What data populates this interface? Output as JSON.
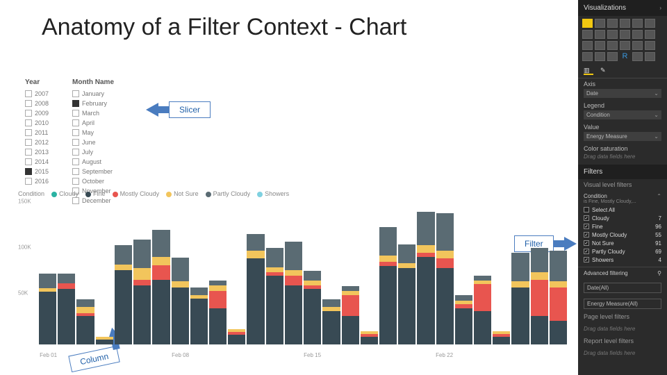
{
  "title": "Anatomy of a Filter Context - Chart",
  "callouts": {
    "slicer": "Slicer",
    "filter": "Filter",
    "column": "Column"
  },
  "slicers": {
    "year": {
      "label": "Year",
      "items": [
        {
          "label": "2007",
          "checked": false
        },
        {
          "label": "2008",
          "checked": false
        },
        {
          "label": "2009",
          "checked": false
        },
        {
          "label": "2010",
          "checked": false
        },
        {
          "label": "2011",
          "checked": false
        },
        {
          "label": "2012",
          "checked": false
        },
        {
          "label": "2013",
          "checked": false
        },
        {
          "label": "2014",
          "checked": false
        },
        {
          "label": "2015",
          "checked": true
        },
        {
          "label": "2016",
          "checked": false
        }
      ]
    },
    "month": {
      "label": "Month Name",
      "items": [
        {
          "label": "January",
          "checked": false
        },
        {
          "label": "February",
          "checked": true
        },
        {
          "label": "March",
          "checked": false
        },
        {
          "label": "April",
          "checked": false
        },
        {
          "label": "May",
          "checked": false
        },
        {
          "label": "June",
          "checked": false
        },
        {
          "label": "July",
          "checked": false
        },
        {
          "label": "August",
          "checked": false
        },
        {
          "label": "September",
          "checked": false
        },
        {
          "label": "October",
          "checked": false
        },
        {
          "label": "November",
          "checked": false
        },
        {
          "label": "December",
          "checked": false
        }
      ]
    }
  },
  "legend": {
    "title": "Condition",
    "items": [
      {
        "label": "Cloudy",
        "color": "#2bb3a3"
      },
      {
        "label": "Fine",
        "color": "#384a54"
      },
      {
        "label": "Mostly Cloudy",
        "color": "#e8554f"
      },
      {
        "label": "Not Sure",
        "color": "#f2c55c"
      },
      {
        "label": "Partly Cloudy",
        "color": "#5a6b73"
      },
      {
        "label": "Showers",
        "color": "#7fd1e0"
      }
    ]
  },
  "chart_data": {
    "type": "bar",
    "stacked": true,
    "ylabel": "",
    "ylim": [
      0,
      150000
    ],
    "yticks": [
      "150K",
      "100K",
      "50K"
    ],
    "xticks": [
      {
        "idx": 0,
        "label": "Feb 01"
      },
      {
        "idx": 7,
        "label": "Feb 08"
      },
      {
        "idx": 14,
        "label": "Feb 15"
      },
      {
        "idx": 21,
        "label": "Feb 22"
      }
    ],
    "categories": [
      "Feb 01",
      "Feb 02",
      "Feb 03",
      "Feb 04",
      "Feb 05",
      "Feb 06",
      "Feb 07",
      "Feb 08",
      "Feb 09",
      "Feb 10",
      "Feb 11",
      "Feb 12",
      "Feb 13",
      "Feb 14",
      "Feb 15",
      "Feb 16",
      "Feb 17",
      "Feb 18",
      "Feb 19",
      "Feb 20",
      "Feb 21",
      "Feb 22",
      "Feb 23",
      "Feb 24",
      "Feb 25",
      "Feb 26",
      "Feb 27",
      "Feb 28"
    ],
    "series_order": [
      "Cloudy",
      "Fine",
      "Mostly Cloudy",
      "Not Sure",
      "Partly Cloudy",
      "Showers"
    ],
    "colors": {
      "Cloudy": "#2bb3a3",
      "Fine": "#384a54",
      "Mostly Cloudy": "#e8554f",
      "Not Sure": "#f2c55c",
      "Partly Cloudy": "#5a6b73",
      "Showers": "#7fd1e0"
    },
    "values": [
      {
        "Fine": 55000,
        "Partly Cloudy": 15000,
        "Not Sure": 4000
      },
      {
        "Fine": 58000,
        "Partly Cloudy": 10000,
        "Mostly Cloudy": 6000
      },
      {
        "Fine": 30000,
        "Partly Cloudy": 8000,
        "Not Sure": 6000,
        "Mostly Cloudy": 3000
      },
      {
        "Fine": 5000,
        "Not Sure": 3000
      },
      {
        "Fine": 78000,
        "Partly Cloudy": 20000,
        "Not Sure": 6000
      },
      {
        "Fine": 62000,
        "Partly Cloudy": 30000,
        "Not Sure": 12000,
        "Mostly Cloudy": 6000
      },
      {
        "Fine": 68000,
        "Partly Cloudy": 28000,
        "Not Sure": 9000,
        "Mostly Cloudy": 15000
      },
      {
        "Fine": 60000,
        "Partly Cloudy": 25000,
        "Not Sure": 6000
      },
      {
        "Fine": 48000,
        "Partly Cloudy": 8000,
        "Not Sure": 4000
      },
      {
        "Fine": 38000,
        "Partly Cloudy": 5000,
        "Not Sure": 6000,
        "Mostly Cloudy": 18000
      },
      {
        "Fine": 10000,
        "Not Sure": 3000,
        "Mostly Cloudy": 3000
      },
      {
        "Fine": 90000,
        "Partly Cloudy": 18000,
        "Not Sure": 8000
      },
      {
        "Fine": 72000,
        "Partly Cloudy": 20000,
        "Not Sure": 5000,
        "Mostly Cloudy": 4000
      },
      {
        "Fine": 62000,
        "Partly Cloudy": 30000,
        "Not Sure": 6000,
        "Mostly Cloudy": 10000
      },
      {
        "Fine": 58000,
        "Partly Cloudy": 10000,
        "Not Sure": 5000,
        "Mostly Cloudy": 4000
      },
      {
        "Fine": 35000,
        "Partly Cloudy": 8000,
        "Not Sure": 4000
      },
      {
        "Fine": 30000,
        "Partly Cloudy": 5000,
        "Not Sure": 4000,
        "Mostly Cloudy": 22000
      },
      {
        "Fine": 8000,
        "Not Sure": 3000,
        "Mostly Cloudy": 3000
      },
      {
        "Fine": 82000,
        "Partly Cloudy": 30000,
        "Not Sure": 6000,
        "Mostly Cloudy": 5000
      },
      {
        "Fine": 80000,
        "Partly Cloudy": 20000,
        "Not Sure": 5000
      },
      {
        "Fine": 92000,
        "Partly Cloudy": 35000,
        "Not Sure": 8000,
        "Mostly Cloudy": 4000
      },
      {
        "Fine": 80000,
        "Partly Cloudy": 40000,
        "Not Sure": 8000,
        "Mostly Cloudy": 10000
      },
      {
        "Fine": 38000,
        "Partly Cloudy": 6000,
        "Not Sure": 4000,
        "Mostly Cloudy": 4000
      },
      {
        "Fine": 35000,
        "Partly Cloudy": 5000,
        "Not Sure": 4000,
        "Mostly Cloudy": 28000
      },
      {
        "Fine": 8000,
        "Not Sure": 3000,
        "Mostly Cloudy": 3000
      },
      {
        "Fine": 60000,
        "Partly Cloudy": 30000,
        "Not Sure": 6000
      },
      {
        "Fine": 30000,
        "Partly Cloudy": 25000,
        "Not Sure": 8000,
        "Mostly Cloudy": 38000
      },
      {
        "Fine": 25000,
        "Mostly Cloudy": 35000,
        "Partly Cloudy": 32000,
        "Not Sure": 6000
      }
    ]
  },
  "rightpane": {
    "title": "Visualizations",
    "tabs": {
      "fields": "Fields",
      "format": "Format"
    },
    "wells": {
      "axis": {
        "label": "Axis",
        "value": "Date"
      },
      "legend": {
        "label": "Legend",
        "value": "Condition"
      },
      "value": {
        "label": "Value",
        "value": "Energy Measure"
      },
      "colorsat": {
        "label": "Color saturation",
        "placeholder": "Drag data fields here"
      }
    },
    "filters": {
      "title": "Filters",
      "visualLevel": "Visual level filters",
      "condition": {
        "label": "Condition",
        "summary": "is Fine, Mostly Cloudy,...",
        "options": [
          {
            "label": "Select All",
            "count": "",
            "checked": false
          },
          {
            "label": "Cloudy",
            "count": "7",
            "checked": true
          },
          {
            "label": "Fine",
            "count": "96",
            "checked": true
          },
          {
            "label": "Mostly Cloudy",
            "count": "55",
            "checked": true
          },
          {
            "label": "Not Sure",
            "count": "91",
            "checked": true
          },
          {
            "label": "Partly Cloudy",
            "count": "69",
            "checked": true
          },
          {
            "label": "Showers",
            "count": "4",
            "checked": true
          }
        ]
      },
      "advanced": "Advanced filtering",
      "date": "Date(All)",
      "energy": "Energy Measure(All)",
      "pageLevel": "Page level filters",
      "pagePlaceholder": "Drag data fields here",
      "reportLevel": "Report level filters",
      "reportPlaceholder": "Drag data fields here"
    }
  }
}
